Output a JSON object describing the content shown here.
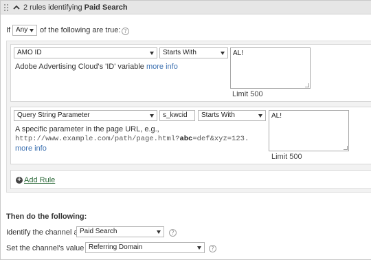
{
  "header": {
    "title_prefix": "2 rules identifying",
    "title_bold": "Paid Search"
  },
  "condition": {
    "prefix": "If",
    "match_select": "Any",
    "suffix": "of the following are true:",
    "help": "?"
  },
  "rules": [
    {
      "field_select": "AMO ID",
      "operator_select": "Starts With",
      "value": "AL!",
      "description": "Adobe Advertising Cloud's 'ID' variable",
      "more_info": "more info",
      "limit": "Limit 500"
    },
    {
      "field_select": "Query String Parameter",
      "param_input": "s_kwcid",
      "operator_select": "Starts With",
      "value": "AL!",
      "description_line1": "A specific parameter in the page URL, e.g.,",
      "example_url_pre": "http://www.example.com/path/page.html?",
      "example_url_bold": "abc",
      "example_url_post": "=def&xyz=123.",
      "more_info": "more info",
      "limit": "Limit 500"
    }
  ],
  "add_rule": {
    "label": "Add Rule"
  },
  "then": {
    "heading": "Then do the following:",
    "channel_label": "Identify the channel as",
    "channel_select": "Paid Search",
    "value_label": "Set the channel's value to",
    "value_select": "Referring Domain",
    "help": "?"
  },
  "icons": {
    "header_drag": "drag-handle-icon",
    "header_collapse": "chevron-up-icon",
    "add_rule": "plus-circle-icon",
    "help": "help-icon",
    "dropdown": "chevron-down-icon"
  },
  "colors": {
    "header_bg": "#e6e6e6",
    "rules_bg": "#f2f2f2",
    "link": "#3a6fb0",
    "add_rule_link": "#2d6a3a"
  }
}
